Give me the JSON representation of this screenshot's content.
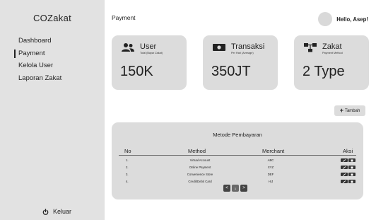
{
  "sidebar": {
    "brand": "COZakat",
    "items": [
      {
        "label": "Dashboard",
        "active": false
      },
      {
        "label": "Payment",
        "active": true
      },
      {
        "label": "Kelola User",
        "active": false
      },
      {
        "label": "Laporan Zakat",
        "active": false
      }
    ],
    "logout_label": "Keluar"
  },
  "header": {
    "title": "Payment",
    "greeting": "Hello, Asep!"
  },
  "cards": [
    {
      "icon": "users-icon",
      "title": "User",
      "subtitle": "Total (Bayar Zakat)",
      "value": "150K"
    },
    {
      "icon": "money-icon",
      "title": "Transaksi",
      "subtitle": "Per Hari (Average)",
      "value": "350JT"
    },
    {
      "icon": "network-icon",
      "title": "Zakat",
      "subtitle": "Payment Method",
      "value": "2 Type"
    }
  ],
  "add_button": {
    "label": "Tambah"
  },
  "payment_table": {
    "title": "Metode Pembayaran",
    "columns": [
      "No",
      "Method",
      "Merchant",
      "Aksi"
    ],
    "rows": [
      {
        "no": "1.",
        "method": "Virtual Account",
        "merchant": "ABC"
      },
      {
        "no": "2.",
        "method": "Online Payment",
        "merchant": "XYZ"
      },
      {
        "no": "3.",
        "method": "Convenience Store",
        "merchant": "DEF"
      },
      {
        "no": "4.",
        "method": "Credit/Debit Card",
        "merchant": "HIJ"
      }
    ]
  },
  "pagination": {
    "prev": "<",
    "current": "1",
    "next": ">"
  }
}
